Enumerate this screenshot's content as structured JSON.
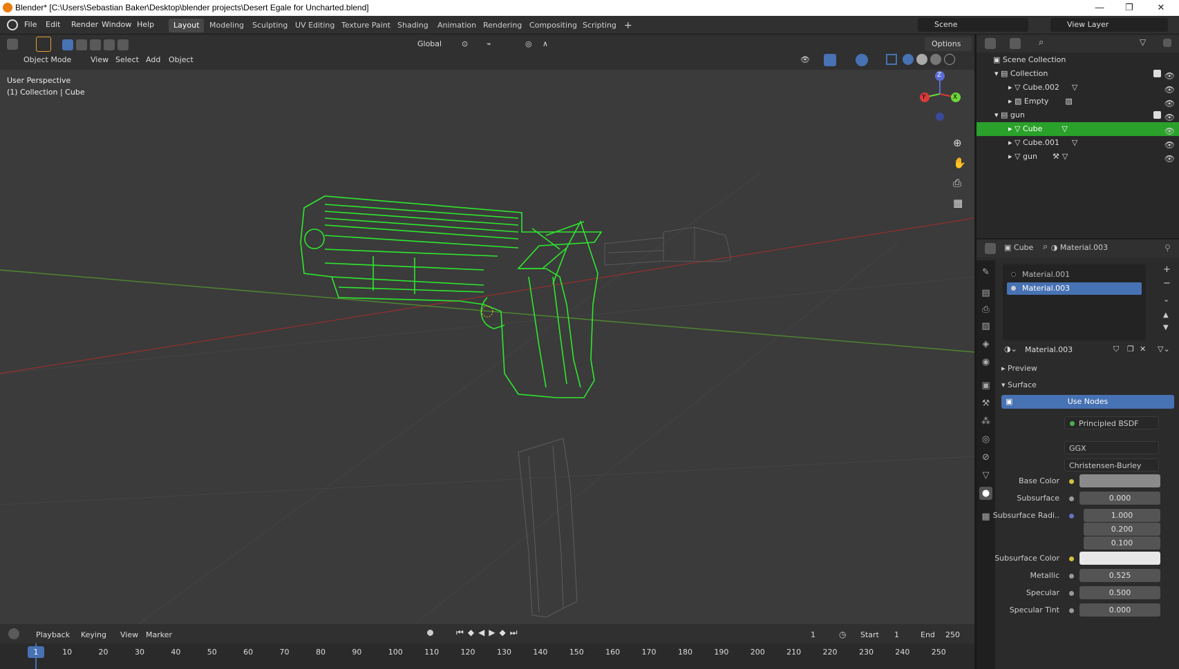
{
  "titlebar": {
    "title": "Blender* [C:\\Users\\Sebastian Baker\\Desktop\\blender projects\\Desert Egale for Uncharted.blend]",
    "minimize": "—",
    "maximize": "❐",
    "close": "✕"
  },
  "menu": [
    "File",
    "Edit",
    "Render",
    "Window",
    "Help"
  ],
  "workspaces": [
    "Layout",
    "Modeling",
    "Sculpting",
    "UV Editing",
    "Texture Paint",
    "Shading",
    "Animation",
    "Rendering",
    "Compositing",
    "Scripting"
  ],
  "add_workspace": "+",
  "scene": {
    "label": "Scene",
    "view_layer": "View Layer"
  },
  "viewport_header": {
    "mode": "Object Mode",
    "view": "View",
    "select": "Select",
    "add": "Add",
    "object": "Object",
    "orientation": "Global",
    "options": "Options"
  },
  "viewport": {
    "perspective": "User Perspective",
    "context": "(1) Collection | Cube",
    "gizmo_z": "Z",
    "gizmo_y": "Y",
    "gizmo_x": "X"
  },
  "outliner": {
    "scene_collection": "Scene Collection",
    "rows": [
      {
        "label": "Collection",
        "type": "collection",
        "depth": 1
      },
      {
        "label": "Cube.002",
        "type": "mesh",
        "depth": 2
      },
      {
        "label": "Empty",
        "type": "empty",
        "depth": 2
      },
      {
        "label": "gun",
        "type": "collection",
        "depth": 1
      },
      {
        "label": "Cube",
        "type": "mesh",
        "depth": 2,
        "selected": true
      },
      {
        "label": "Cube.001",
        "type": "mesh",
        "depth": 2
      },
      {
        "label": "gun",
        "type": "mesh",
        "depth": 2
      }
    ]
  },
  "properties": {
    "object_name": "Cube",
    "material_name": "Material.003",
    "slots": [
      "Material.001",
      "Material.003"
    ],
    "active_slot": "Material.003",
    "material_field": "Material.003",
    "preview": "Preview",
    "surface_panel": "Surface",
    "use_nodes": "Use Nodes",
    "surface_label": "Surface",
    "surface_shader": "Principled BSDF",
    "distribution": "GGX",
    "subsurface_method": "Christensen-Burley",
    "fields": [
      {
        "label": "Base Color",
        "value": ""
      },
      {
        "label": "Subsurface",
        "value": "0.000"
      },
      {
        "label": "Subsurface Radi..",
        "value": "1.000"
      },
      {
        "label": "",
        "value": "0.200"
      },
      {
        "label": "",
        "value": "0.100"
      },
      {
        "label": "Subsurface Color",
        "value": ""
      },
      {
        "label": "Metallic",
        "value": "0.525"
      },
      {
        "label": "Specular",
        "value": "0.500"
      },
      {
        "label": "Specular Tint",
        "value": "0.000"
      }
    ],
    "base_color": "#8a8a8a",
    "subsurface_color": "#e8e8e8"
  },
  "timeline": {
    "playback": "Playback",
    "keying": "Keying",
    "view": "View",
    "marker": "Marker",
    "current_frame": "1",
    "start_label": "Start",
    "start": "1",
    "end_label": "End",
    "end": "250",
    "ruler": [
      "1",
      "10",
      "20",
      "30",
      "40",
      "50",
      "60",
      "70",
      "80",
      "90",
      "100",
      "110",
      "120",
      "130",
      "140",
      "150",
      "160",
      "170",
      "180",
      "190",
      "200",
      "210",
      "220",
      "230",
      "240",
      "250"
    ]
  },
  "colors": {
    "accent_blue": "#4772b3",
    "selection_green": "#2aa12a",
    "wire_green": "#2ee82e"
  }
}
